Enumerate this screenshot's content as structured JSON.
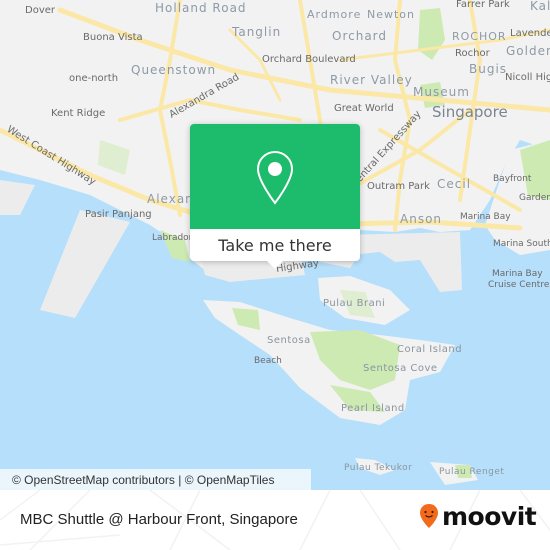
{
  "map": {
    "colors": {
      "water": "#b6dffb",
      "land": "#f2f2f2",
      "park": "#cdeab3",
      "road": "#fbe8a6",
      "accent_green": "#1dbb6c",
      "moovit_orange": "#f26b1d"
    },
    "labels": {
      "dover": "Dover",
      "holland_road": "Holland Road",
      "ardmore": "Ardmore",
      "newton": "Newton",
      "farrer_park": "Farrer Park",
      "kallang": "Kall",
      "buona_vista": "Buona Vista",
      "tanglin": "Tanglin",
      "orchard": "Orchard",
      "rochor_district": "ROCHOR",
      "lavender": "Lavender",
      "rochor": "Rochor",
      "golden_mile": "Golden",
      "queenstown": "Queenstown",
      "orchard_boulevard": "Orchard Boulevard",
      "river_valley": "River Valley",
      "bugis": "Bugis",
      "nicoll_highway": "Nicoll High",
      "one_north": "one-north",
      "alexandra_road": "Alexandra Road",
      "museum": "Museum",
      "kent_ridge": "Kent Ridge",
      "great_world": "Great World",
      "singapore": "Singapore",
      "west_coast_highway": "West Coast Highway",
      "central_expressway": "Central Expressway",
      "outram_park": "Outram Park",
      "cecil": "Cecil",
      "bayfront": "Bayfront",
      "alexandra": "Alexandra",
      "gardens": "Gardens",
      "pasir_panjang": "Pasir Panjang",
      "anson": "Anson",
      "marina_bay": "Marina Bay",
      "labrador": "Labrador",
      "highway": "Highway",
      "marina_south": "Marina South",
      "pulau_brani": "Pulau Brani",
      "marina_bay_cruise_centre_1": "Marina Bay",
      "marina_bay_cruise_centre_2": "Cruise Centre",
      "sentosa": "Sentosa",
      "coral_island": "Coral Island",
      "beach": "Beach",
      "sentosa_cove": "Sentosa Cove",
      "pearl_island": "Pearl Island",
      "pulau_tekukor": "Pulau Tekukor",
      "pulau_renget": "Pulau Renget"
    }
  },
  "popup": {
    "icon": "map-pin-icon",
    "button_label": "Take me there"
  },
  "attribution": "© OpenStreetMap contributors | © OpenMapTiles",
  "footer": {
    "stop_name": "MBC Shuttle @ Harbour Front, Singapore",
    "logo_text": "moovit",
    "logo_icon": "moovit-smiley-pin-icon"
  }
}
